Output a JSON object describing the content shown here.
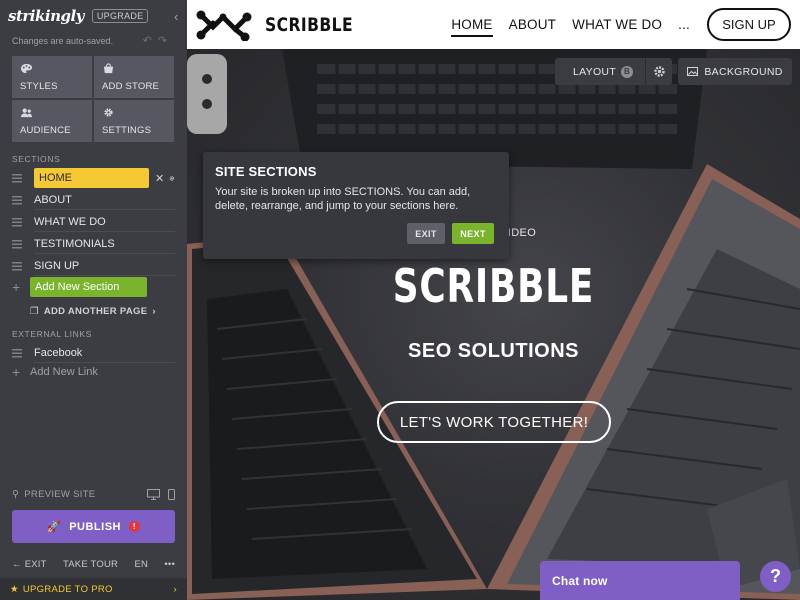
{
  "sidebar": {
    "brand": "strikingly",
    "upgrade_badge": "UPGRADE",
    "autosave_text": "Changes are auto-saved.",
    "tiles": [
      {
        "label": "STYLES",
        "icon": "palette-icon"
      },
      {
        "label": "ADD STORE",
        "icon": "store-icon"
      },
      {
        "label": "AUDIENCE",
        "icon": "audience-icon"
      },
      {
        "label": "SETTINGS",
        "icon": "gear-icon"
      }
    ],
    "sections_heading": "SECTIONS",
    "sections": [
      "HOME",
      "ABOUT",
      "WHAT WE DO",
      "TESTIMONIALS",
      "SIGN UP"
    ],
    "add_section": "Add New Section",
    "add_page": "ADD ANOTHER PAGE",
    "external_heading": "EXTERNAL LINKS",
    "external_links": [
      "Facebook"
    ],
    "add_link": "Add New Link",
    "preview": "PREVIEW SITE",
    "publish": "PUBLISH",
    "publish_alert": "!",
    "exit": "EXIT",
    "tour": "TAKE TOUR",
    "lang": "EN",
    "more": "•••",
    "upgrade_pro": "UPGRADE TO PRO"
  },
  "site": {
    "name": "SCRIBBLE",
    "nav": [
      "HOME",
      "ABOUT",
      "WHAT WE DO",
      "..."
    ],
    "signup": "SIGN UP"
  },
  "editor": {
    "layout_label": "LAYOUT",
    "layout_badge": "B",
    "background_label": "BACKGROUND"
  },
  "hero": {
    "video_tag": "VIDEO",
    "title": "SCRIBBLE",
    "subtitle": "SEO SOLUTIONS",
    "cta": "LET'S WORK TOGETHER!"
  },
  "popover": {
    "title": "SITE SECTIONS",
    "body": "Your site is broken up into SECTIONS. You can add, delete, rearrange, and jump to your sections here.",
    "exit": "EXIT",
    "next": "NEXT"
  },
  "chat": {
    "label": "Chat now",
    "help": "?"
  }
}
